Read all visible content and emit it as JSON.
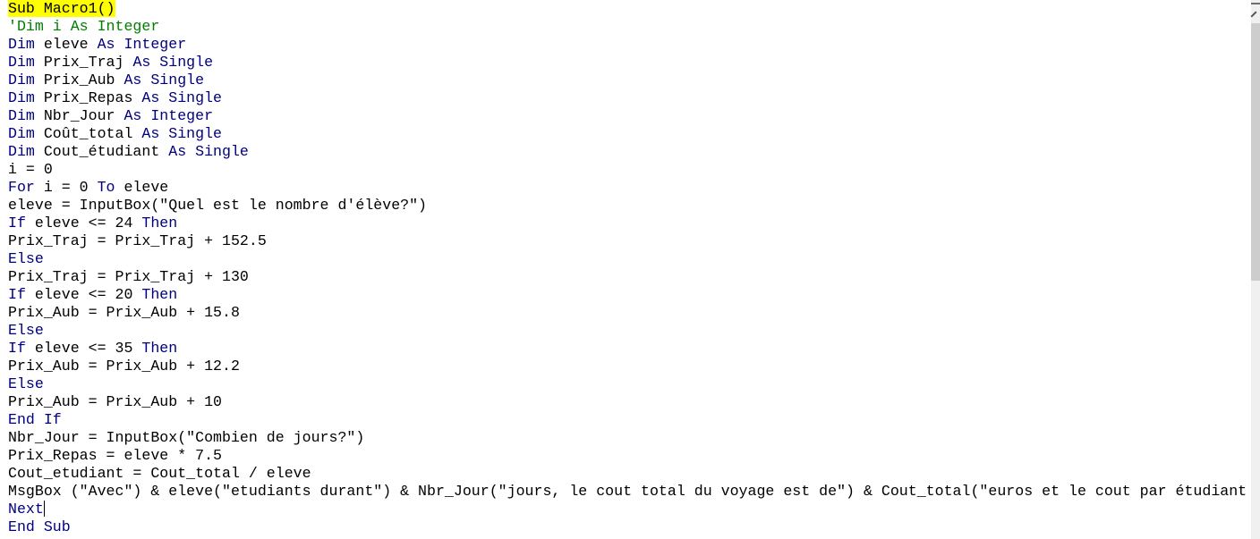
{
  "editor": {
    "lines": [
      {
        "parts": [
          {
            "t": "Sub Macro1()",
            "c": "hl"
          }
        ]
      },
      {
        "parts": [
          {
            "t": "'Dim i As Integer",
            "c": "cm"
          }
        ]
      },
      {
        "parts": [
          {
            "t": "Dim ",
            "c": "kw"
          },
          {
            "t": "eleve ",
            "c": "tx"
          },
          {
            "t": "As Integer",
            "c": "kw"
          }
        ]
      },
      {
        "parts": [
          {
            "t": "Dim ",
            "c": "kw"
          },
          {
            "t": "Prix_Traj ",
            "c": "tx"
          },
          {
            "t": "As Single",
            "c": "kw"
          }
        ]
      },
      {
        "parts": [
          {
            "t": "Dim ",
            "c": "kw"
          },
          {
            "t": "Prix_Aub ",
            "c": "tx"
          },
          {
            "t": "As Single",
            "c": "kw"
          }
        ]
      },
      {
        "parts": [
          {
            "t": "Dim ",
            "c": "kw"
          },
          {
            "t": "Prix_Repas ",
            "c": "tx"
          },
          {
            "t": "As Single",
            "c": "kw"
          }
        ]
      },
      {
        "parts": [
          {
            "t": "Dim ",
            "c": "kw"
          },
          {
            "t": "Nbr_Jour ",
            "c": "tx"
          },
          {
            "t": "As Integer",
            "c": "kw"
          }
        ]
      },
      {
        "parts": [
          {
            "t": "Dim ",
            "c": "kw"
          },
          {
            "t": "Coût_total ",
            "c": "tx"
          },
          {
            "t": "As Single",
            "c": "kw"
          }
        ]
      },
      {
        "parts": [
          {
            "t": "Dim ",
            "c": "kw"
          },
          {
            "t": "Cout_étudiant ",
            "c": "tx"
          },
          {
            "t": "As Single",
            "c": "kw"
          }
        ]
      },
      {
        "parts": [
          {
            "t": "i = 0",
            "c": "tx"
          }
        ]
      },
      {
        "parts": [
          {
            "t": "For ",
            "c": "kw"
          },
          {
            "t": "i = 0 ",
            "c": "tx"
          },
          {
            "t": "To ",
            "c": "kw"
          },
          {
            "t": "eleve",
            "c": "tx"
          }
        ]
      },
      {
        "parts": [
          {
            "t": "eleve = InputBox(\"Quel est le nombre d'élève?\")",
            "c": "tx"
          }
        ]
      },
      {
        "parts": [
          {
            "t": "If ",
            "c": "kw"
          },
          {
            "t": "eleve <= 24 ",
            "c": "tx"
          },
          {
            "t": "Then",
            "c": "kw"
          }
        ]
      },
      {
        "parts": [
          {
            "t": "Prix_Traj = Prix_Traj + 152.5",
            "c": "tx"
          }
        ]
      },
      {
        "parts": [
          {
            "t": "Else",
            "c": "kw"
          }
        ]
      },
      {
        "parts": [
          {
            "t": "Prix_Traj = Prix_Traj + 130",
            "c": "tx"
          }
        ]
      },
      {
        "parts": [
          {
            "t": "If ",
            "c": "kw"
          },
          {
            "t": "eleve <= 20 ",
            "c": "tx"
          },
          {
            "t": "Then",
            "c": "kw"
          }
        ]
      },
      {
        "parts": [
          {
            "t": "Prix_Aub = Prix_Aub + 15.8",
            "c": "tx"
          }
        ]
      },
      {
        "parts": [
          {
            "t": "Else",
            "c": "kw"
          }
        ]
      },
      {
        "parts": [
          {
            "t": "If ",
            "c": "kw"
          },
          {
            "t": "eleve <= 35 ",
            "c": "tx"
          },
          {
            "t": "Then",
            "c": "kw"
          }
        ]
      },
      {
        "parts": [
          {
            "t": "Prix_Aub = Prix_Aub + 12.2",
            "c": "tx"
          }
        ]
      },
      {
        "parts": [
          {
            "t": "Else",
            "c": "kw"
          }
        ]
      },
      {
        "parts": [
          {
            "t": "Prix_Aub = Prix_Aub + 10",
            "c": "tx"
          }
        ]
      },
      {
        "parts": [
          {
            "t": "End If",
            "c": "kw"
          }
        ]
      },
      {
        "parts": [
          {
            "t": "Nbr_Jour = InputBox(\"Combien de jours?\")",
            "c": "tx"
          }
        ]
      },
      {
        "parts": [
          {
            "t": "Prix_Repas = eleve * 7.5",
            "c": "tx"
          }
        ]
      },
      {
        "parts": [
          {
            "t": "Cout_etudiant = Cout_total / eleve",
            "c": "tx"
          }
        ]
      },
      {
        "parts": [
          {
            "t": "MsgBox (\"Avec\") & eleve(\"etudiants durant\") & Nbr_Jour(\"jours, le cout total du voyage est de\") & Cout_total(\"euros et le cout par étudiant",
            "c": "tx"
          }
        ]
      },
      {
        "parts": [
          {
            "t": "Next",
            "c": "kw"
          }
        ],
        "caret": true
      },
      {
        "parts": [
          {
            "t": "End Sub",
            "c": "kw"
          }
        ]
      }
    ]
  },
  "colors": {
    "keyword": "#00007f",
    "comment": "#008000",
    "text": "#000000",
    "execution_highlight": "#ffff00"
  }
}
